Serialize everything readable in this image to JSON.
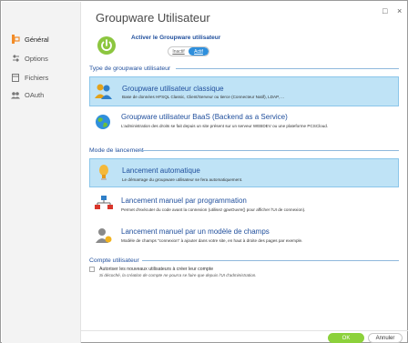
{
  "window": {
    "title": "Groupware Utilisateur",
    "controls": {
      "restore": "□",
      "close": "×"
    }
  },
  "sidebar": {
    "items": [
      {
        "label": "Général",
        "icon": "general-icon",
        "active": true
      },
      {
        "label": "Options",
        "icon": "options-icon",
        "active": false
      },
      {
        "label": "Fichiers",
        "icon": "files-icon",
        "active": false
      },
      {
        "label": "OAuth",
        "icon": "oauth-icon",
        "active": false
      }
    ]
  },
  "activation": {
    "label": "Activer le Groupware utilisateur",
    "options": [
      "Inactif",
      "Actif"
    ],
    "selected": "Actif"
  },
  "groupware_type": {
    "section_title": "Type de groupware utilisateur",
    "options": [
      {
        "title": "Groupware utilisateur classique",
        "description": "Base de données HFSQL Classic, Client/Serveur ou tierce (Connecteur Natif), LDAP, ...",
        "selected": true,
        "icon": "users-icon"
      },
      {
        "title": "Groupware utilisateur BaaS (Backend as a Service)",
        "description": "L'administration des droits se fait depuis un site présent sur un serveur WEBDEV ou une plateforme PCSCloud.",
        "selected": false,
        "icon": "globe-icon"
      }
    ]
  },
  "launch_mode": {
    "section_title": "Mode de lancement",
    "options": [
      {
        "title": "Lancement automatique",
        "description": "Le démarrage du groupware utilisateur se fera automatiquement.",
        "selected": true,
        "icon": "auto-launch-icon"
      },
      {
        "title": "Lancement manuel par programmation",
        "description": "Permet d'exécuter du code avant la connexion (utilisez gpwOuvre() pour afficher l'UI de connexion).",
        "selected": false,
        "icon": "network-icon"
      },
      {
        "title": "Lancement manuel par un modèle de champs",
        "description": "Modèle de champs \"connexion\" à ajouter dans votre site, en haut à droite des pages par exemple.",
        "selected": false,
        "icon": "user-model-icon"
      }
    ]
  },
  "account": {
    "section_title": "Compte utilisateur",
    "checkbox_label": "Autoriser les nouveaux utilisateurs à créer leur compte",
    "checkbox_checked": false,
    "note": "Si décoché, la création de compte ne pourra se faire que depuis l'UI d'administration."
  },
  "footer": {
    "ok_label": "OK",
    "cancel_label": "Annuler"
  },
  "colors": {
    "accent": "#1f4e9c",
    "selected_bg": "#bfe3f6",
    "ok_green": "#8cd13b",
    "toggle_blue": "#2f8fdc"
  }
}
